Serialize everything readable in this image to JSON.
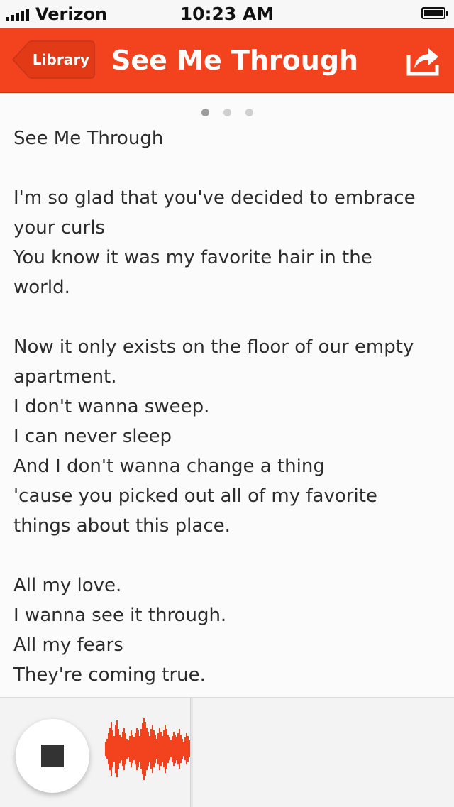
{
  "status_bar": {
    "carrier": "Verizon",
    "time": "10:23 AM"
  },
  "nav": {
    "back_label": "Library",
    "title": "See Me Through",
    "accent_color": "#f2431e"
  },
  "pager": {
    "page_count": 3,
    "current_page": 1
  },
  "lyrics": {
    "lines": [
      "See Me Through",
      "",
      "I'm so glad that you've decided to embrace",
      "your curls",
      "You know it was my favorite hair in the",
      "world.",
      "",
      "Now it only exists on the floor of our empty",
      "apartment.",
      "I don't wanna sweep.",
      "I can never sleep",
      "And I don't wanna change a thing",
      "'cause you picked out all of my favorite",
      "things about this place.",
      "",
      "All my love.",
      "I wanna see it through.",
      "All my fears",
      "They're coming true."
    ]
  },
  "player": {
    "state": "recording",
    "waveform_color": "#f2431e",
    "icons": [
      "stop-icon",
      "waveform-icon"
    ]
  }
}
